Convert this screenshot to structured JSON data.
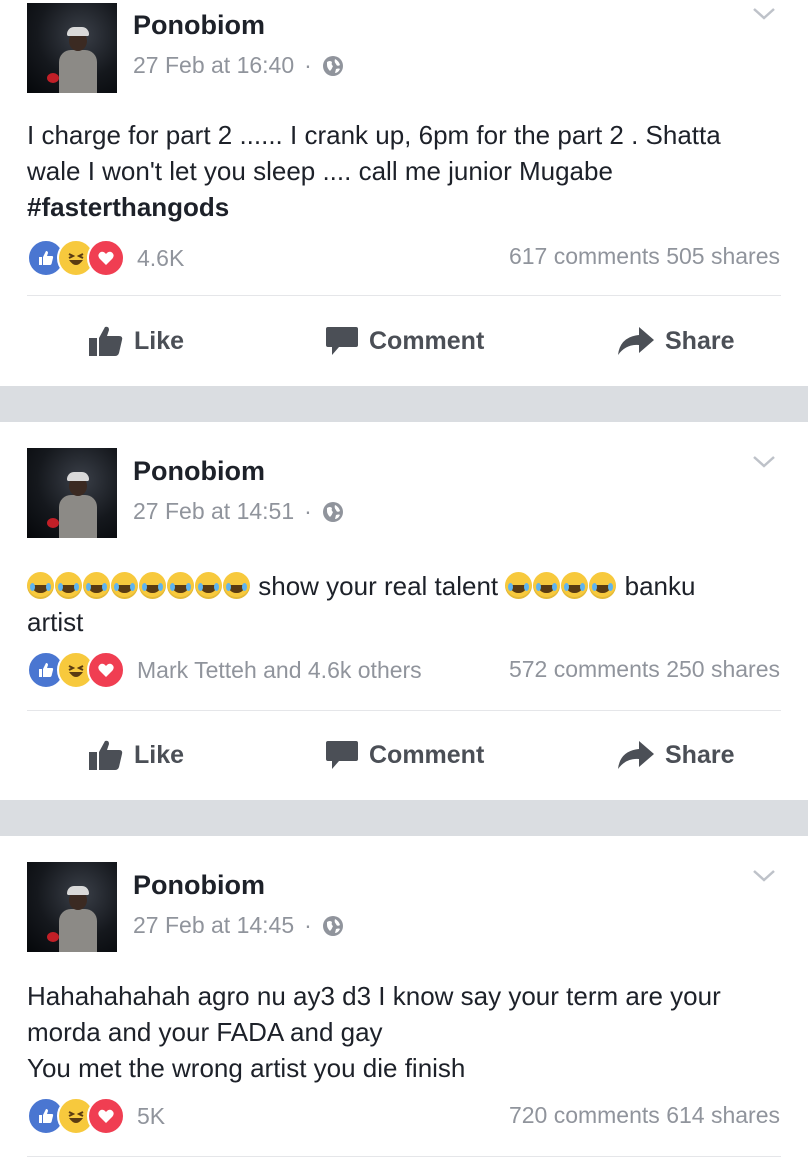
{
  "posts": [
    {
      "author": "Ponobiom",
      "timestamp": "27 Feb at 16:40",
      "separator": "·",
      "text_lines": [
        "I charge for part 2 ...... I crank up, 6pm for the part 2 . Shatta",
        "wale I won't let you sleep .... call me junior Mugabe"
      ],
      "hashtag": "#fasterthangods",
      "reactions_label": "4.6K",
      "comments": "617 comments",
      "shares": "505 shares"
    },
    {
      "author": "Ponobiom",
      "timestamp": "27 Feb at 14:51",
      "separator": "·",
      "text_part1": "show your real talent",
      "text_part2": "banku",
      "text_line2": "artist",
      "emoji_name": "tears-of-joy-emoji",
      "reactions_label": "Mark Tetteh and 4.6k others",
      "comments": "572 comments",
      "shares": "250 shares"
    },
    {
      "author": "Ponobiom",
      "timestamp": "27 Feb at 14:45",
      "separator": "·",
      "text_lines": [
        "Hahahahahah agro nu ay3 d3 I know say your term are your",
        "morda and your FADA and gay",
        "You met the wrong artist you die finish"
      ],
      "reactions_label": "5K",
      "comments": "720 comments",
      "shares": "614 shares"
    }
  ],
  "actions": {
    "like": "Like",
    "comment": "Comment",
    "share": "Share"
  },
  "colors": {
    "like_blue": "#4a76d1",
    "haha_yellow": "#f7c93d",
    "love_red": "#f03e52",
    "meta_gray": "#90949c",
    "action_gray": "#4b4f56",
    "separator_gray": "#dadde1"
  },
  "icons": [
    "globe-icon",
    "chevron-down-icon",
    "like-icon",
    "comment-icon",
    "share-icon"
  ]
}
